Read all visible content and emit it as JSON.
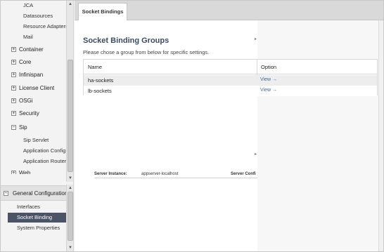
{
  "sidebar": {
    "tree_children_top": [
      {
        "label": "JCA"
      },
      {
        "label": "Datasources"
      },
      {
        "label": "Resource Adapters"
      },
      {
        "label": "Mail"
      }
    ],
    "tree_parents": [
      {
        "label": "Container"
      },
      {
        "label": "Core"
      },
      {
        "label": "Infinispan"
      },
      {
        "label": "License Client"
      },
      {
        "label": "OSGi"
      },
      {
        "label": "Security"
      },
      {
        "label": "Sip"
      }
    ],
    "sip_children": [
      {
        "label": "Sip Servlet"
      },
      {
        "label": "Application Config"
      },
      {
        "label": "Application Router"
      }
    ],
    "partial_item": "Web",
    "general_configuration": {
      "header": "General Configuration",
      "items": [
        {
          "label": "Interfaces"
        },
        {
          "label": "Socket Binding"
        },
        {
          "label": "System Properties"
        }
      ]
    }
  },
  "tabs": [
    {
      "label": "Socket Bindings"
    }
  ],
  "panel": {
    "title": "Socket Binding Groups",
    "description": "Please chose a group from below for specific settings.",
    "table": {
      "columns": [
        "Name",
        "Option"
      ],
      "rows": [
        {
          "name": "ha-sockets",
          "option": "View →"
        },
        {
          "name": "lb-sockets",
          "option": "View →"
        }
      ]
    },
    "server_instance_label": "Server Instance:",
    "server_instance_value": "appserver-localhost",
    "server_config_label": "Server Confi"
  },
  "icons": {
    "expand": "plus-box",
    "collapse": "minus-box",
    "scroll_up": "arrow-up",
    "scroll_down": "arrow-down"
  },
  "colors": {
    "title": "#3a4b63",
    "selected_bg": "#4a5466",
    "link": "#3c6aa6",
    "row_highlight": "#ededed"
  }
}
